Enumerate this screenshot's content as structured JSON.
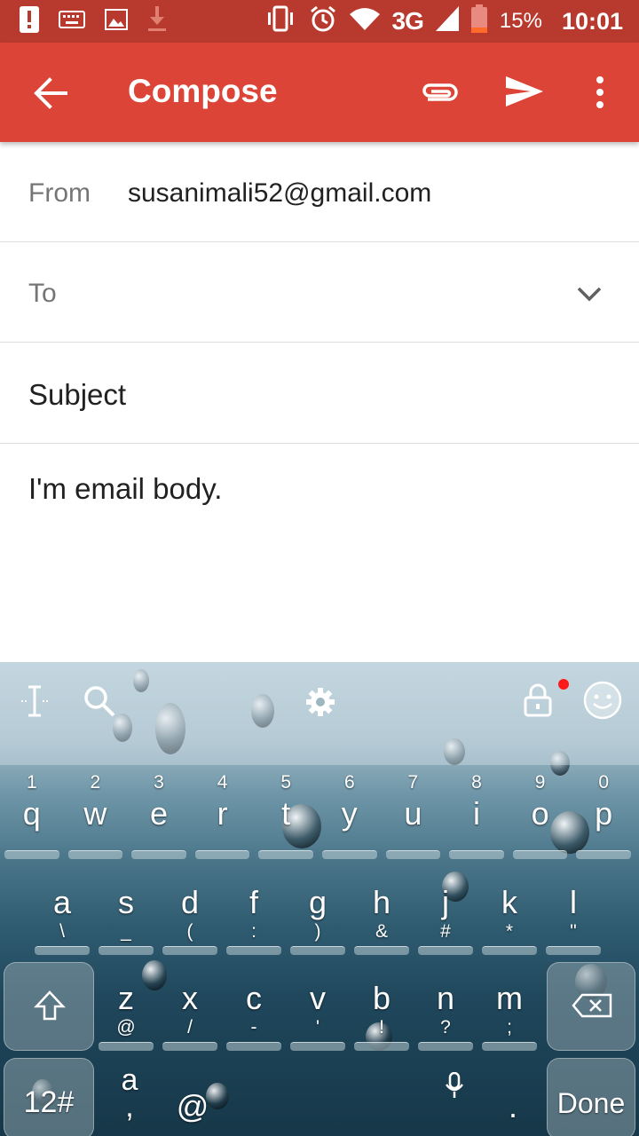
{
  "status_bar": {
    "network": "3G",
    "battery": "15%",
    "time": "10:01",
    "icons": [
      "warning-icon",
      "keyboard-icon",
      "image-icon",
      "download-icon",
      "vibrate-icon",
      "alarm-icon",
      "wifi-icon",
      "signal-icon",
      "battery-icon"
    ]
  },
  "app_bar": {
    "title": "Compose",
    "icons": [
      "back-arrow-icon",
      "attach-icon",
      "send-icon",
      "more-vert-icon"
    ]
  },
  "form": {
    "from_label": "From",
    "from_value": "susanimali52@gmail.com",
    "to_label": "To",
    "subject_placeholder": "Subject",
    "body": "I'm email body."
  },
  "keyboard": {
    "toolbar_icons": [
      "text-cursor-icon",
      "search-icon",
      "settings-gear-icon",
      "lock-icon",
      "emoji-icon"
    ],
    "row1": [
      {
        "main": "q",
        "sec": "1"
      },
      {
        "main": "w",
        "sec": "2"
      },
      {
        "main": "e",
        "sec": "3"
      },
      {
        "main": "r",
        "sec": "4"
      },
      {
        "main": "t",
        "sec": "5"
      },
      {
        "main": "y",
        "sec": "6"
      },
      {
        "main": "u",
        "sec": "7"
      },
      {
        "main": "i",
        "sec": "8"
      },
      {
        "main": "o",
        "sec": "9"
      },
      {
        "main": "p",
        "sec": "0"
      }
    ],
    "row2": [
      {
        "main": "a",
        "sec": "\\"
      },
      {
        "main": "s",
        "sec": "_"
      },
      {
        "main": "d",
        "sec": "("
      },
      {
        "main": "f",
        "sec": ":"
      },
      {
        "main": "g",
        "sec": ")"
      },
      {
        "main": "h",
        "sec": "&"
      },
      {
        "main": "j",
        "sec": "#"
      },
      {
        "main": "k",
        "sec": "*"
      },
      {
        "main": "l",
        "sec": "\""
      }
    ],
    "row3": [
      {
        "main": "z",
        "sec": "@"
      },
      {
        "main": "x",
        "sec": "/"
      },
      {
        "main": "c",
        "sec": "-"
      },
      {
        "main": "v",
        "sec": "'"
      },
      {
        "main": "b",
        "sec": "!"
      },
      {
        "main": "n",
        "sec": "?"
      },
      {
        "main": "m",
        "sec": ";"
      }
    ],
    "symbols_key": "12#",
    "comma_key": {
      "main": ",",
      "sec": "a"
    },
    "at_key": "@",
    "period_key": ".",
    "done_key": "Done"
  }
}
